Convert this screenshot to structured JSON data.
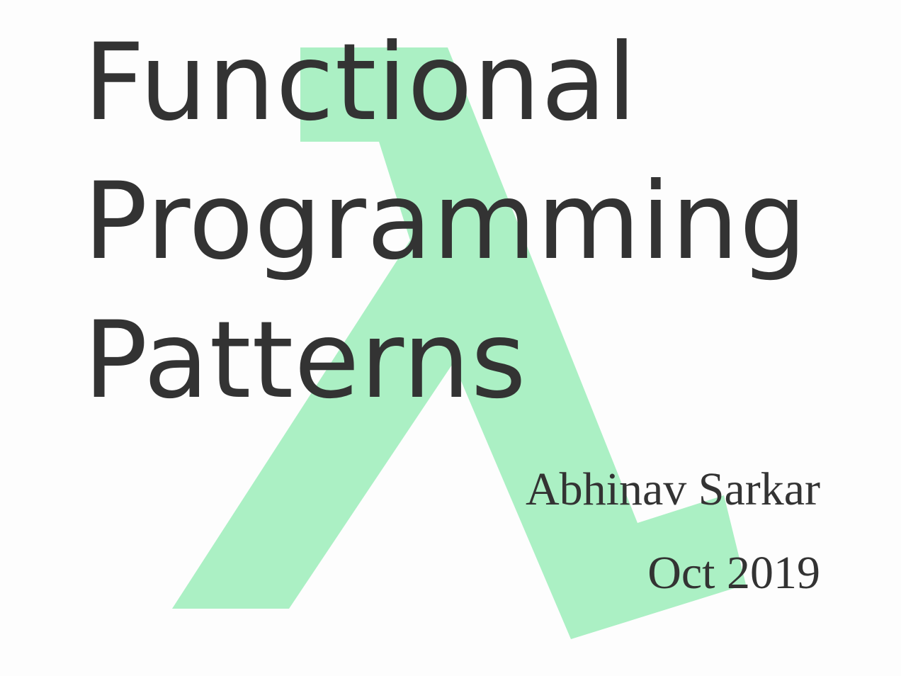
{
  "title_lines": [
    "Functional",
    "Programming",
    "Patterns"
  ],
  "author": "Abhinav Sarkar",
  "date": "Oct 2019",
  "colors": {
    "lambda": "#abf0c4",
    "text": "#333333",
    "background": "#fdfdfd"
  },
  "icons": {
    "background_logo": "lambda-icon"
  }
}
